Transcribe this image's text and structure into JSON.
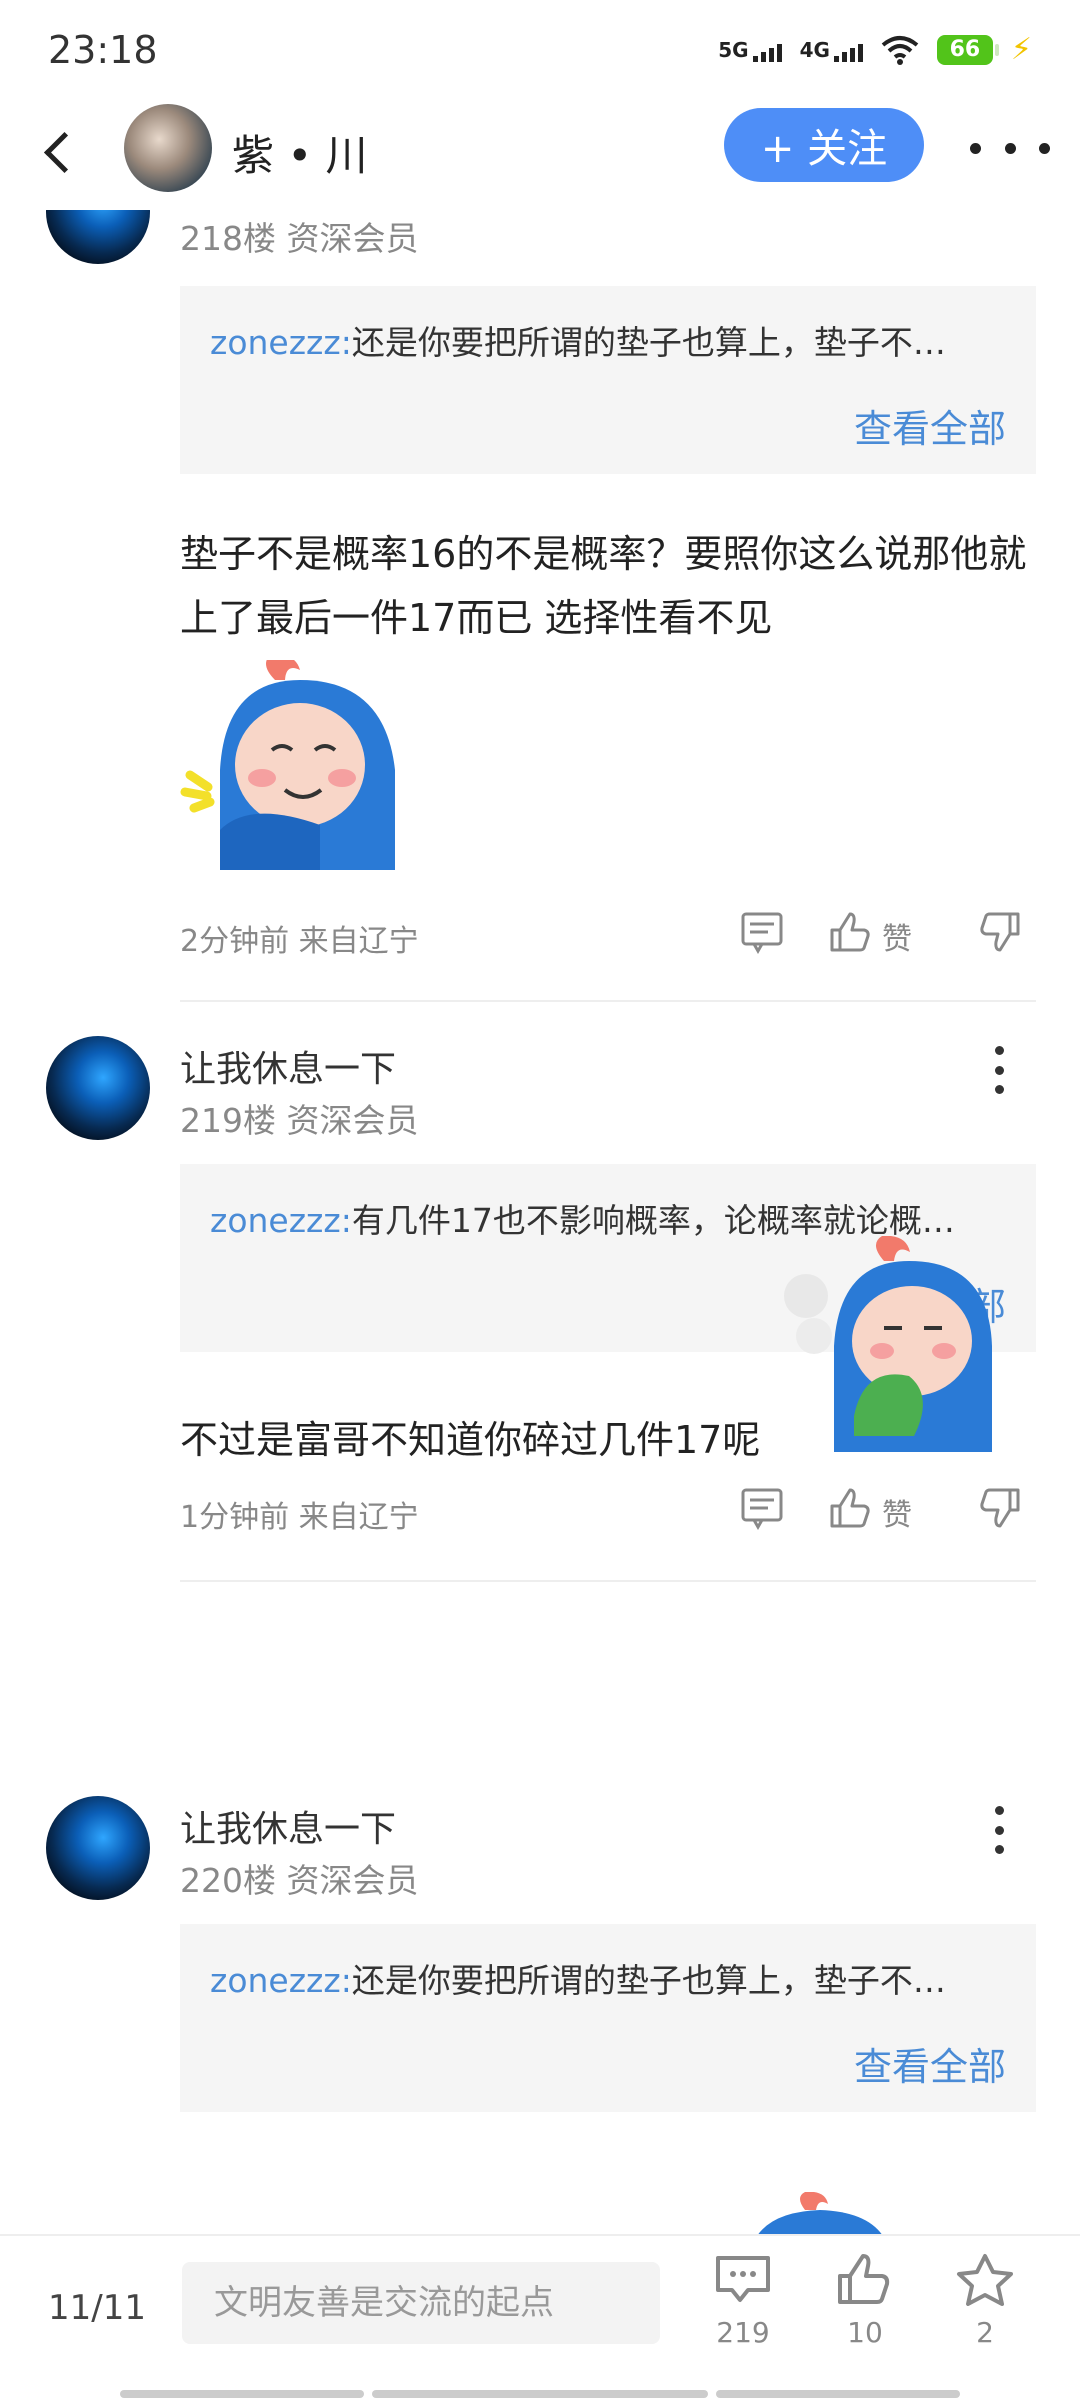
{
  "status_bar": {
    "time": "23:18",
    "net1": "5G",
    "net2": "4G",
    "battery": "66"
  },
  "header": {
    "author_name": "紫 • 川",
    "follow_label": "+ 关注"
  },
  "posts": [
    {
      "floor": "218楼 资深会员",
      "quote_user": "zonezzz:",
      "quote_text": "还是你要把所谓的垫子也算上，垫子不…",
      "view_all": "查看全部",
      "text": "垫子不是概率16的不是概率？要照你这么说那他就上了最后一件17而已 选择性看不见",
      "time": "2分钟前 来自辽宁",
      "like_label": "赞"
    },
    {
      "author": "让我休息一下",
      "floor": "219楼 资深会员",
      "quote_user": "zonezzz:",
      "quote_text": "有几件17也不影响概率，论概率就论概…",
      "view_all": "查看全部",
      "text": "不过是富哥不知道你碎过几件17呢",
      "time": "1分钟前 来自辽宁",
      "like_label": "赞"
    },
    {
      "author": "让我休息一下",
      "floor": "220楼 资深会员",
      "quote_user": "zonezzz:",
      "quote_text": "还是你要把所谓的垫子也算上，垫子不…",
      "view_all": "查看全部"
    }
  ],
  "bottom_bar": {
    "page_indicator": "11/11",
    "input_placeholder": "文明友善是交流的起点",
    "comments_count": "219",
    "likes_count": "10",
    "favorites_count": "2"
  }
}
